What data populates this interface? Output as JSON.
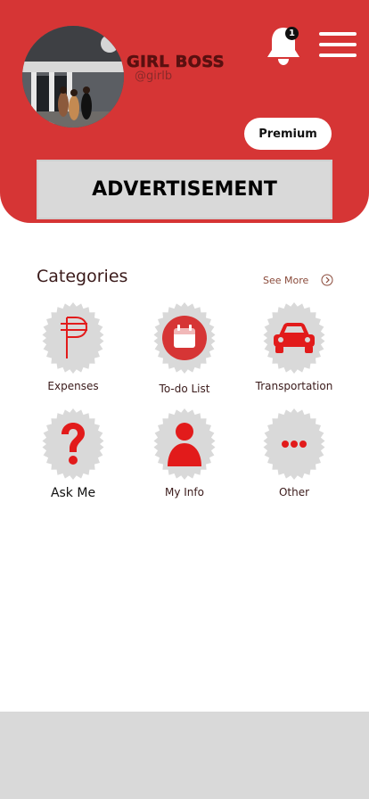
{
  "profile": {
    "name": "GIRL BOSS",
    "handle": "@girlb"
  },
  "notifications": {
    "count": "1",
    "icon": "bell-icon"
  },
  "menu": {
    "icon": "hamburger-menu-icon"
  },
  "premium_label": "Premium",
  "advertisement": "ADVERTISEMENT",
  "categories": {
    "title": "Categories",
    "see_more": "See More",
    "items": [
      {
        "label": "Expenses",
        "icon": "peso-sign-icon"
      },
      {
        "label": "To-do List",
        "icon": "calendar-icon"
      },
      {
        "label": "Transportation",
        "icon": "car-icon"
      },
      {
        "label": "Ask Me",
        "icon": "question-mark-icon"
      },
      {
        "label": "My Info",
        "icon": "person-icon"
      },
      {
        "label": "Other",
        "icon": "ellipsis-icon"
      }
    ]
  },
  "colors": {
    "header": "#d63535",
    "accent_red": "#e21b1b",
    "badge_grey": "#d9d9d9",
    "footer": "#d9d9d9"
  }
}
